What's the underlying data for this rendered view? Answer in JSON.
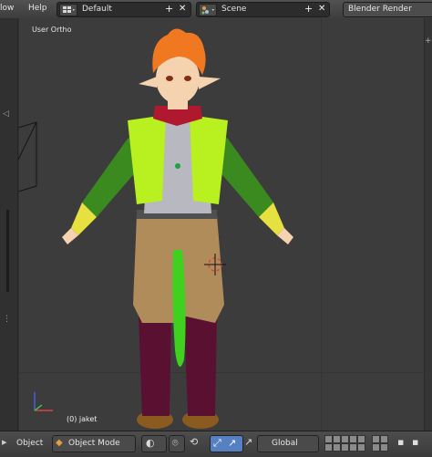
{
  "top_header": {
    "menu_window_partial": "low",
    "menu_help": "Help",
    "screen_layout": "Default",
    "scene": "Scene",
    "add_symbol": "+",
    "close_symbol": "✕",
    "render_engine": "Blender Render"
  },
  "viewport": {
    "view_label": "User Ortho",
    "object_label": "(0) jaket",
    "background_color": "#3c3c3c",
    "character": {
      "hair_color": "#f07820",
      "skin_color": "#f5d2b0",
      "vest_color": "#b8f020",
      "sleeve_color": "#3a8a20",
      "shirt_color": "#b8b8c0",
      "scarf_color": "#b01830",
      "pants_color": "#b08c5a",
      "tail_color": "#40d020",
      "legs_color": "#5a1030",
      "boots_color": "#8a5a20"
    }
  },
  "bottom_header": {
    "menu_object": "Object",
    "mode": "Object Mode",
    "transform_orientation": "Global"
  },
  "colors": {
    "accent_blue": "#5680c2",
    "header_bg": "#474747"
  }
}
